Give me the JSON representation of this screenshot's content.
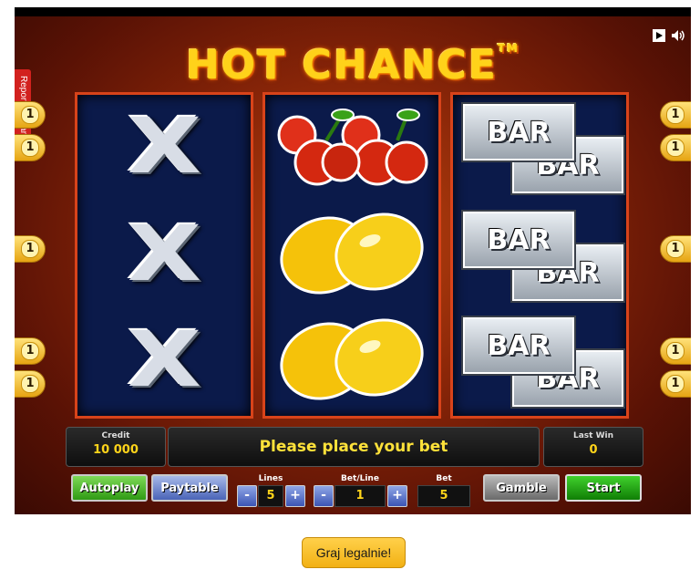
{
  "game": {
    "title": "HOT CHANCE",
    "trademark": "TM",
    "report_label": "Report the game",
    "icons": {
      "play": "play-icon",
      "sound": "speaker-icon"
    }
  },
  "reels": [
    [
      "X",
      "X",
      "X"
    ],
    [
      "cherries",
      "lemons",
      "lemons"
    ],
    [
      "BAR",
      "BAR",
      "BAR"
    ]
  ],
  "bar_text": "BAR",
  "line_indicators": {
    "left": [
      "1",
      "1",
      "1",
      "1",
      "1"
    ],
    "right": [
      "1",
      "1",
      "1",
      "1",
      "1"
    ]
  },
  "status": {
    "credit_label": "Credit",
    "credit_value": "10 000",
    "message": "Please place your bet",
    "last_win_label": "Last Win",
    "last_win_value": "0"
  },
  "controls": {
    "autoplay": "Autoplay",
    "paytable": "Paytable",
    "lines_label": "Lines",
    "lines_value": "5",
    "betline_label": "Bet/Line",
    "betline_value": "1",
    "bet_label": "Bet",
    "bet_value": "5",
    "minus": "-",
    "plus": "+",
    "gamble": "Gamble",
    "start": "Start"
  },
  "cta": {
    "label": "Graj legalnie!"
  },
  "colors": {
    "accent": "#ffd21a",
    "reel_bg": "#0b1a4a",
    "reel_border": "#d8431a",
    "cta": "#f2b114"
  }
}
